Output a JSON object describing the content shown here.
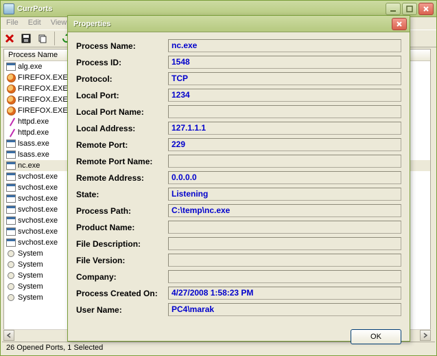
{
  "main": {
    "title": "CurrPorts",
    "menu": [
      "File",
      "Edit",
      "View"
    ],
    "col_header": "Process Name",
    "status": "26 Opened Ports, 1 Selected",
    "rows": [
      {
        "icon": "win",
        "text": "alg.exe",
        "sel": false
      },
      {
        "icon": "ff",
        "text": "FIREFOX.EXE",
        "sel": false
      },
      {
        "icon": "ff",
        "text": "FIREFOX.EXE",
        "sel": false
      },
      {
        "icon": "ff",
        "text": "FIREFOX.EXE",
        "sel": false
      },
      {
        "icon": "ff",
        "text": "FIREFOX.EXE",
        "sel": false
      },
      {
        "icon": "httpd",
        "text": "httpd.exe",
        "sel": false
      },
      {
        "icon": "httpd",
        "text": "httpd.exe",
        "sel": false
      },
      {
        "icon": "win",
        "text": "lsass.exe",
        "sel": false
      },
      {
        "icon": "win",
        "text": "lsass.exe",
        "sel": false
      },
      {
        "icon": "win",
        "text": "nc.exe",
        "sel": true
      },
      {
        "icon": "win",
        "text": "svchost.exe",
        "sel": false
      },
      {
        "icon": "win",
        "text": "svchost.exe",
        "sel": false
      },
      {
        "icon": "win",
        "text": "svchost.exe",
        "sel": false
      },
      {
        "icon": "win",
        "text": "svchost.exe",
        "sel": false
      },
      {
        "icon": "win",
        "text": "svchost.exe",
        "sel": false
      },
      {
        "icon": "win",
        "text": "svchost.exe",
        "sel": false
      },
      {
        "icon": "win",
        "text": "svchost.exe",
        "sel": false
      },
      {
        "icon": "radio",
        "text": "System",
        "sel": false
      },
      {
        "icon": "radio",
        "text": "System",
        "sel": false
      },
      {
        "icon": "radio",
        "text": "System",
        "sel": false
      },
      {
        "icon": "radio",
        "text": "System",
        "sel": false
      },
      {
        "icon": "radio",
        "text": "System",
        "sel": false
      }
    ]
  },
  "dialog": {
    "title": "Properties",
    "ok_label": "OK",
    "props": [
      {
        "label": "Process Name:",
        "value": "nc.exe"
      },
      {
        "label": "Process ID:",
        "value": "1548"
      },
      {
        "label": "Protocol:",
        "value": "TCP"
      },
      {
        "label": "Local Port:",
        "value": "1234"
      },
      {
        "label": "Local Port Name:",
        "value": ""
      },
      {
        "label": "Local Address:",
        "value": "127.1.1.1"
      },
      {
        "label": "Remote Port:",
        "value": "229"
      },
      {
        "label": "Remote Port Name:",
        "value": ""
      },
      {
        "label": "Remote Address:",
        "value": "0.0.0.0"
      },
      {
        "label": "State:",
        "value": "Listening"
      },
      {
        "label": "Process Path:",
        "value": "C:\\temp\\nc.exe"
      },
      {
        "label": "Product Name:",
        "value": ""
      },
      {
        "label": "File Description:",
        "value": ""
      },
      {
        "label": "File Version:",
        "value": ""
      },
      {
        "label": "Company:",
        "value": ""
      },
      {
        "label": "Process Created On:",
        "value": "4/27/2008 1:58:23 PM"
      },
      {
        "label": "User Name:",
        "value": "PC4\\marak"
      }
    ]
  }
}
